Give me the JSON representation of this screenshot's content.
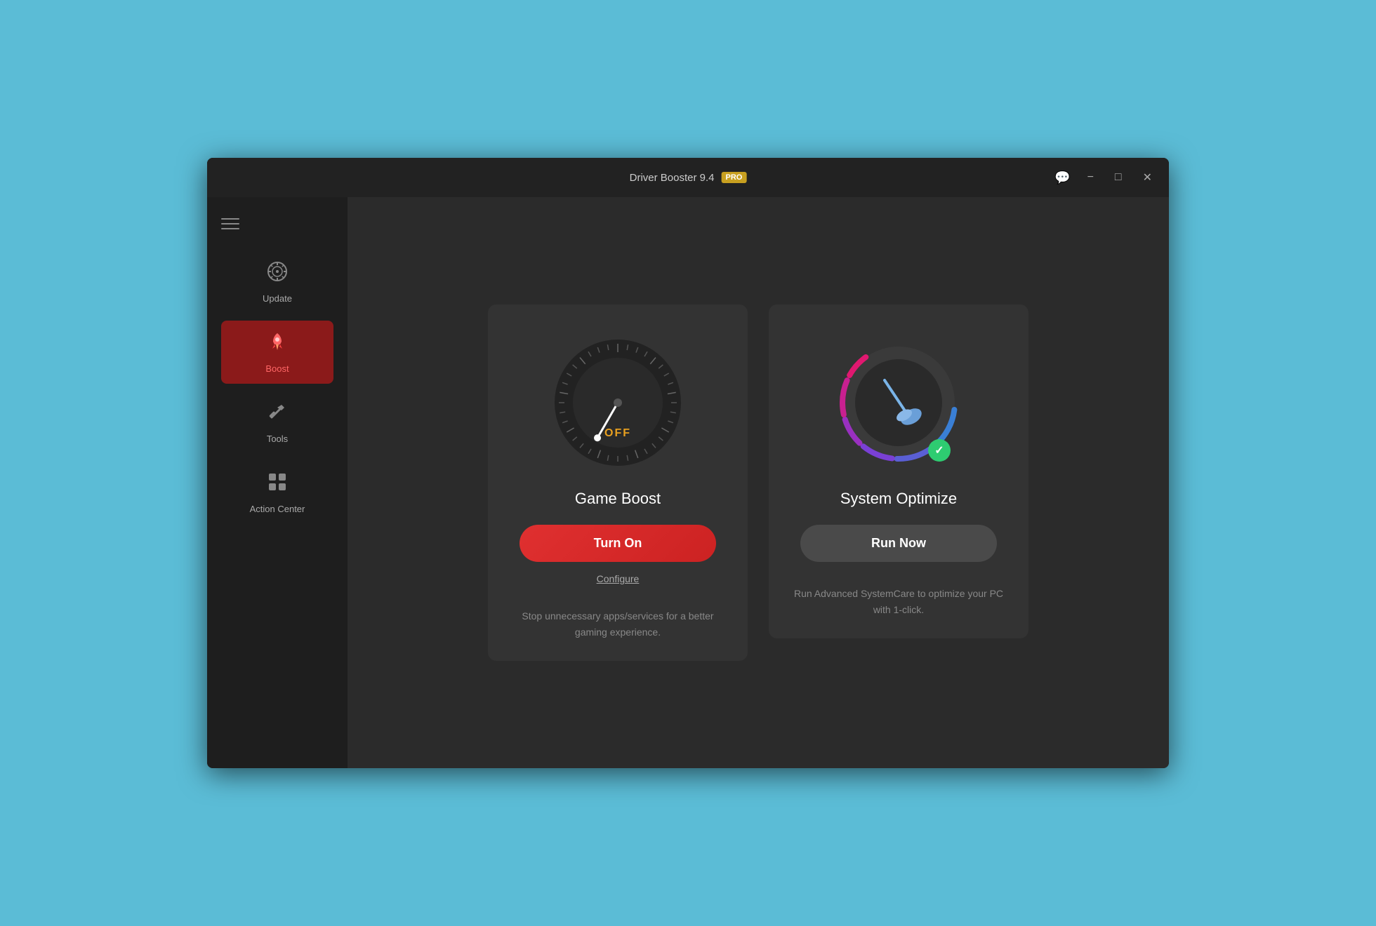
{
  "titlebar": {
    "title": "Driver Booster 9.4",
    "pro_badge": "PRO",
    "minimize_label": "−",
    "maximize_label": "□",
    "close_label": "✕"
  },
  "sidebar": {
    "hamburger_label": "menu",
    "items": [
      {
        "id": "update",
        "label": "Update",
        "icon": "⚙",
        "active": false
      },
      {
        "id": "boost",
        "label": "Boost",
        "icon": "🚀",
        "active": true
      },
      {
        "id": "tools",
        "label": "Tools",
        "icon": "🔧",
        "active": false
      },
      {
        "id": "action-center",
        "label": "Action Center",
        "icon": "⊞",
        "active": false
      }
    ]
  },
  "cards": {
    "game_boost": {
      "title": "Game Boost",
      "status": "OFF",
      "button_label": "Turn On",
      "configure_label": "Configure",
      "description": "Stop unnecessary apps/services for a better gaming experience."
    },
    "system_optimize": {
      "title": "System Optimize",
      "button_label": "Run Now",
      "description": "Run Advanced SystemCare to optimize your PC with 1-click."
    }
  },
  "colors": {
    "accent_red": "#e03030",
    "accent_orange": "#e8a020",
    "accent_green": "#2ecc71",
    "sidebar_bg": "#1e1e1e",
    "card_bg": "#333333",
    "main_bg": "#2b2b2b"
  }
}
